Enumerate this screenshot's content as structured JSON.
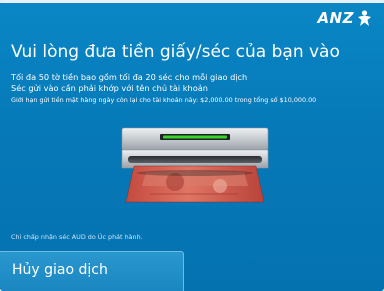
{
  "brand": {
    "name": "ANZ"
  },
  "title": "Vui lòng đưa tiền giấy/séc của bạn vào",
  "instructions": {
    "line1": "Tối đa 50 tờ tiền bao gồm tối đa 20 séc cho mỗi giao dịch",
    "line2": "Séc gửi vào cần phải khớp với tên chủ tài khoản",
    "limit_note": "Giới hạn gửi tiền mặt hàng ngày còn lại cho tài khoản này: $2,000.00 trong tổng số $10,000.00"
  },
  "footer_note": "Chỉ chấp nhận séc AUD do Úc phát hành.",
  "cancel_button": {
    "label": "Hủy giao dịch"
  },
  "colors": {
    "background": "#0679b8",
    "slot_light": "#3ad12a",
    "text": "#ffffff"
  },
  "icons": {
    "logo": "anz-person-icon",
    "illustration": "cash-slot-illustration"
  }
}
